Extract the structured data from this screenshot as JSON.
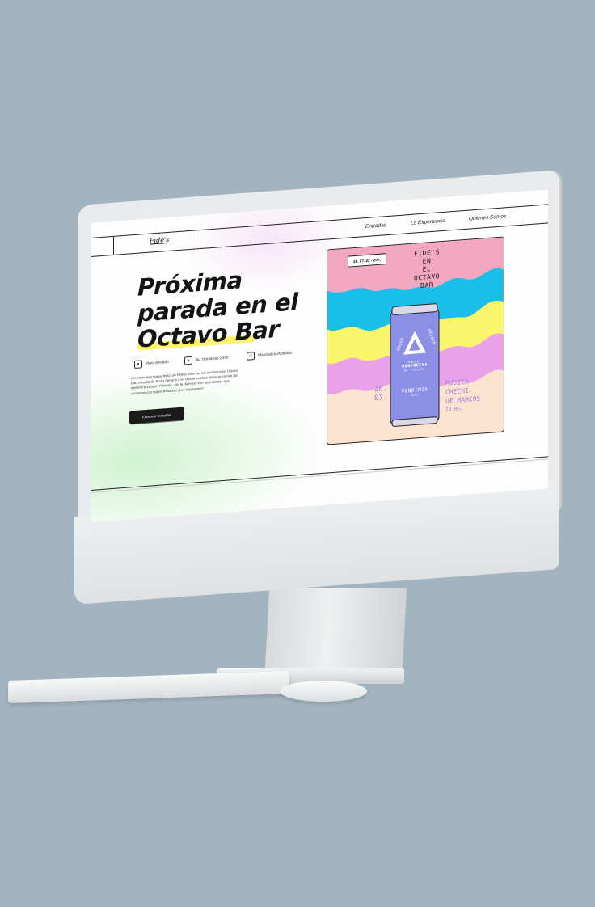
{
  "colors": {
    "background": "#a2b4c0",
    "highlight": "#fff36b",
    "cta_bg": "#1b1b1b",
    "poster_pink": "#f4a7c1",
    "poster_cyan": "#19bfe8",
    "poster_yellow": "#fbf56c",
    "poster_violet": "#e9a1ea",
    "can_blue": "#8b8fe6",
    "event_text": "#9c7ee0"
  },
  "nav": {
    "logo": "Fide's",
    "links": [
      "Entradas",
      "La Experiencia",
      "Quiénes Somos"
    ]
  },
  "hero": {
    "title_line1": "Próxima",
    "title_line2": "parada en el",
    "title_line3": "Octavo Bar",
    "features": [
      {
        "icon": "user-icon",
        "label": "Mora limitado"
      },
      {
        "icon": "location-pin-icon",
        "label": "Av. Honduras 2356"
      },
      {
        "icon": "box-icon",
        "label": "Materiales incluidos"
      }
    ],
    "description": "¡Se viene una nueva fecha de Fide's! Esta vez las recibimos en Octavo Bar, cerquita de Plaza Serrano y en donde muchos dicen se comen las mejores pizzas de Palermo. ¡No te duermas con las entradas que contamos con cupos limitados! ¡Los esperamos!",
    "cta_label": "Comprar entradas"
  },
  "poster": {
    "date_badge": "26. 07. 22 - 20h.",
    "title_lines": [
      "FIDE'S",
      "EN",
      "EL",
      "OCTAVO",
      "BAR"
    ],
    "can_brand_left": "ANDES",
    "can_brand_right": "ORIGEN",
    "can_line1": "MALBEC",
    "can_line2": "MENDOCINA",
    "can_line3": "DE TRIUNFO",
    "can_line4": "VENDIMIA",
    "can_line5": "2022",
    "date_left": [
      "26.",
      "07."
    ],
    "event_right": [
      "MUSICA",
      "CHECHI",
      "DE MARCOS",
      "20 HS."
    ]
  }
}
